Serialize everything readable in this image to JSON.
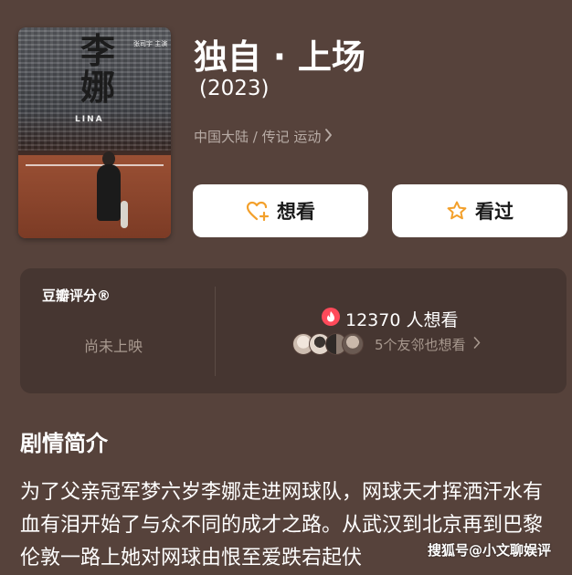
{
  "poster": {
    "title_text": "李娜",
    "subtitle_text": "张司宇 主演",
    "li_text": "LINA"
  },
  "header": {
    "title": "独自 · 上场",
    "year": "(2023)",
    "meta": "中国大陆 / 传记 运动"
  },
  "actions": {
    "want_label": "想看",
    "seen_label": "看过"
  },
  "rating": {
    "label": "豆瓣评分®",
    "status": "尚未上映",
    "want_count_text": "12370 人想看",
    "friends_text": "5个友邻也想看"
  },
  "synopsis": {
    "title": "剧情简介",
    "text": "为了父亲冠军梦六岁李娜走进网球队，网球天才挥洒汗水有血有泪开始了与众不同的成才之路。从武汉到北京再到巴黎伦敦一路上她对网球由恨至爱跌宕起伏"
  },
  "watermark": "搜狐号@小文聊娱评",
  "icons": {
    "want": "heart-plus-icon",
    "seen": "star-outline-icon",
    "fire": "fire-icon",
    "chevron": "chevron-right-icon"
  },
  "colors": {
    "background": "#56423b",
    "card": "#463631",
    "accent": "#f3a02b",
    "fire": "#ff4a5a"
  }
}
